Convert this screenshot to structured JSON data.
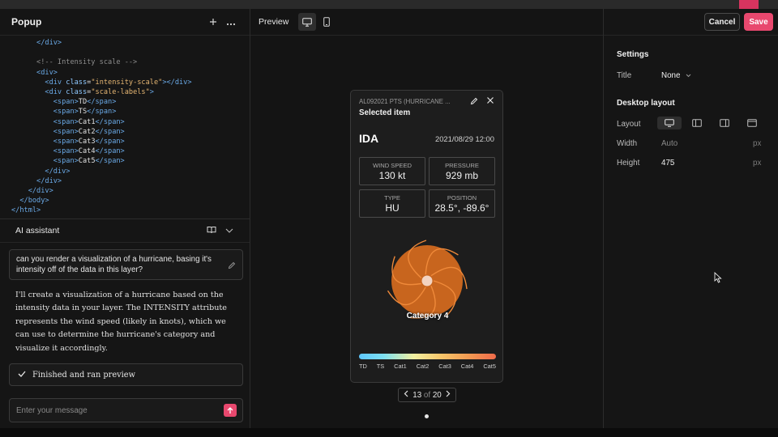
{
  "left_panel": {
    "title": "Popup",
    "add_icon": "plus-icon",
    "more_icon": "ellipsis-icon"
  },
  "code_lines": [
    [
      {
        "t": "txt",
        "v": "      "
      },
      {
        "t": "tag",
        "v": "</div>"
      }
    ],
    [
      {
        "t": "txt",
        "v": ""
      }
    ],
    [
      {
        "t": "txt",
        "v": "      "
      },
      {
        "t": "com",
        "v": "<!-- Intensity scale -->"
      }
    ],
    [
      {
        "t": "txt",
        "v": "      "
      },
      {
        "t": "tag",
        "v": "<div>"
      }
    ],
    [
      {
        "t": "txt",
        "v": "        "
      },
      {
        "t": "tag",
        "v": "<div "
      },
      {
        "t": "attr",
        "v": "class"
      },
      {
        "t": "txt",
        "v": "="
      },
      {
        "t": "str",
        "v": "\"intensity-scale\""
      },
      {
        "t": "tag",
        "v": "></div>"
      }
    ],
    [
      {
        "t": "txt",
        "v": "        "
      },
      {
        "t": "tag",
        "v": "<div "
      },
      {
        "t": "attr",
        "v": "class"
      },
      {
        "t": "txt",
        "v": "="
      },
      {
        "t": "str",
        "v": "\"scale-labels\""
      },
      {
        "t": "tag",
        "v": ">"
      }
    ],
    [
      {
        "t": "txt",
        "v": "          "
      },
      {
        "t": "tag",
        "v": "<span>"
      },
      {
        "t": "txt",
        "v": "TD"
      },
      {
        "t": "tag",
        "v": "</span>"
      }
    ],
    [
      {
        "t": "txt",
        "v": "          "
      },
      {
        "t": "tag",
        "v": "<span>"
      },
      {
        "t": "txt",
        "v": "TS"
      },
      {
        "t": "tag",
        "v": "</span>"
      }
    ],
    [
      {
        "t": "txt",
        "v": "          "
      },
      {
        "t": "tag",
        "v": "<span>"
      },
      {
        "t": "txt",
        "v": "Cat1"
      },
      {
        "t": "tag",
        "v": "</span>"
      }
    ],
    [
      {
        "t": "txt",
        "v": "          "
      },
      {
        "t": "tag",
        "v": "<span>"
      },
      {
        "t": "txt",
        "v": "Cat2"
      },
      {
        "t": "tag",
        "v": "</span>"
      }
    ],
    [
      {
        "t": "txt",
        "v": "          "
      },
      {
        "t": "tag",
        "v": "<span>"
      },
      {
        "t": "txt",
        "v": "Cat3"
      },
      {
        "t": "tag",
        "v": "</span>"
      }
    ],
    [
      {
        "t": "txt",
        "v": "          "
      },
      {
        "t": "tag",
        "v": "<span>"
      },
      {
        "t": "txt",
        "v": "Cat4"
      },
      {
        "t": "tag",
        "v": "</span>"
      }
    ],
    [
      {
        "t": "txt",
        "v": "          "
      },
      {
        "t": "tag",
        "v": "<span>"
      },
      {
        "t": "txt",
        "v": "Cat5"
      },
      {
        "t": "tag",
        "v": "</span>"
      }
    ],
    [
      {
        "t": "txt",
        "v": "        "
      },
      {
        "t": "tag",
        "v": "</div>"
      }
    ],
    [
      {
        "t": "txt",
        "v": "      "
      },
      {
        "t": "tag",
        "v": "</div>"
      }
    ],
    [
      {
        "t": "txt",
        "v": "    "
      },
      {
        "t": "tag",
        "v": "</div>"
      }
    ],
    [
      {
        "t": "txt",
        "v": "  "
      },
      {
        "t": "tag",
        "v": "</body>"
      }
    ],
    [
      {
        "t": "tag",
        "v": "</html>"
      }
    ]
  ],
  "ai_assistant": {
    "title": "AI assistant",
    "docs_icon": "book-icon",
    "collapse_icon": "chevron-down-icon",
    "user_prompt": "can you render a visualization of a hurricane, basing it's intensity off of the data in this layer?",
    "response": "I'll create a visualization of a hurricane based on the intensity data in your layer. The INTENSITY attribute represents the wind speed (likely in knots), which we can use to determine the hurricane's category and visualize it accordingly.",
    "status": "Finished and ran preview",
    "input_placeholder": "Enter your message"
  },
  "preview": {
    "label": "Preview",
    "device_desktop_icon": "monitor-icon",
    "device_mobile_icon": "phone-icon",
    "popup": {
      "layer_name": "AL092021 PTS (HURRICANE ...",
      "heading": "Selected item",
      "storm_name": "IDA",
      "datetime": "2021/08/29 12:00",
      "stats": [
        {
          "label": "WIND SPEED",
          "value": "130 kt"
        },
        {
          "label": "PRESSURE",
          "value": "929 mb"
        },
        {
          "label": "TYPE",
          "value": "HU"
        },
        {
          "label": "POSITION",
          "value": "28.5°, -89.6°"
        }
      ],
      "category_label": "Category 4",
      "scale_labels": [
        "TD",
        "TS",
        "Cat1",
        "Cat2",
        "Cat3",
        "Cat4",
        "Cat5"
      ],
      "storm_color": "#c8651e",
      "arm_color": "#f08a3a"
    },
    "pager": {
      "current": "13",
      "of": "of",
      "total": "20"
    }
  },
  "settings": {
    "cancel_label": "Cancel",
    "save_label": "Save",
    "section_title": "Settings",
    "title_label": "Title",
    "title_value": "None",
    "desktop_section": "Desktop layout",
    "layout_label": "Layout",
    "width_label": "Width",
    "width_placeholder": "Auto",
    "width_unit": "px",
    "height_label": "Height",
    "height_value": "475",
    "height_unit": "px"
  },
  "colors": {
    "accent": "#e8486e",
    "background": "#141414"
  }
}
